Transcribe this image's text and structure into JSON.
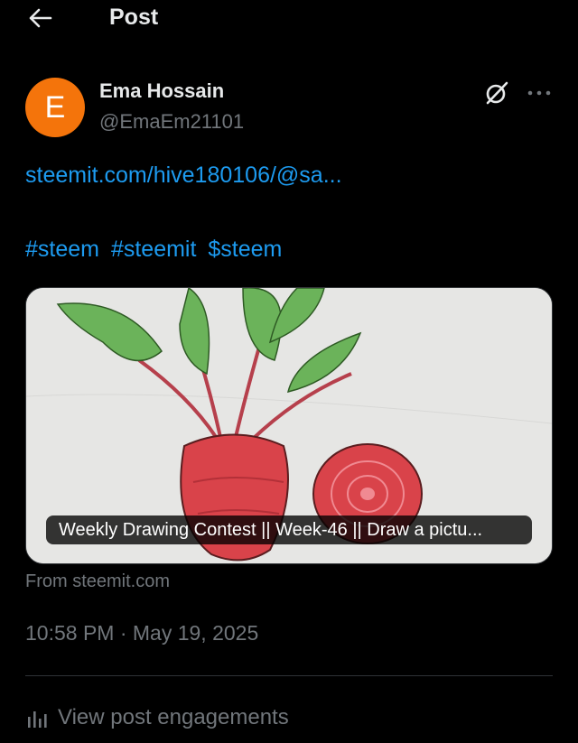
{
  "header": {
    "title": "Post"
  },
  "author": {
    "avatar_letter": "E",
    "avatar_color": "#f4740b",
    "name": "Ema Hossain",
    "handle": "@EmaEm21101"
  },
  "post": {
    "link_text": "steemit.com/hive180106/@sa...",
    "hashtags": [
      "#steem",
      "#steemit",
      "$steem"
    ],
    "card_title": "Weekly Drawing Contest || Week-46 || Draw a pictu...",
    "source": "From steemit.com",
    "timestamp": "10:58 PM · May 19, 2025"
  },
  "engagements": {
    "label": "View post engagements"
  },
  "icons": {
    "back": "arrow-left-icon",
    "grok": "grok-icon",
    "more": "more-dots-icon",
    "engagements": "bar-chart-icon"
  },
  "colors": {
    "background": "#000000",
    "text": "#e7e9ea",
    "muted": "#71767b",
    "link": "#1d9bf0"
  }
}
